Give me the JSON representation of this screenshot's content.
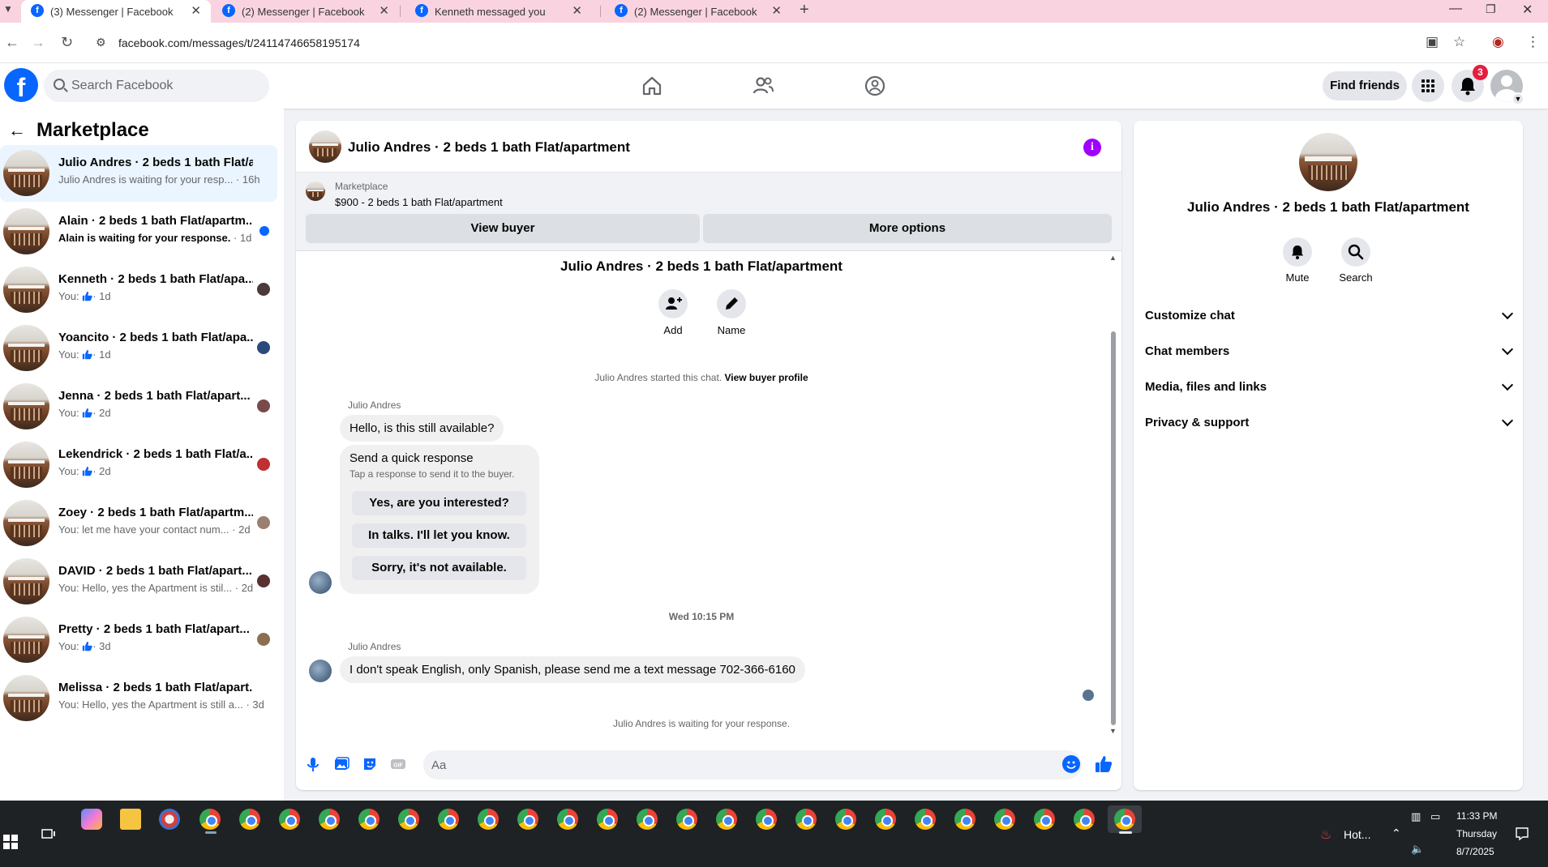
{
  "browser": {
    "tabs": [
      {
        "title": "(3) Messenger | Facebook",
        "active": true
      },
      {
        "title": "(2) Messenger | Facebook",
        "active": false
      },
      {
        "title": "Kenneth messaged you",
        "active": false
      },
      {
        "title": "(2) Messenger | Facebook",
        "active": false
      }
    ],
    "url": "facebook.com/messages/t/24114746658195174"
  },
  "fb_header": {
    "search_placeholder": "Search Facebook",
    "find_friends_label": "Find friends",
    "notification_count": "3"
  },
  "sidebar": {
    "title": "Marketplace",
    "conversations": [
      {
        "name": "Julio Andres · 2 beds 1 bath Flat/a...",
        "preview": "Julio Andres is waiting for your resp...",
        "time": "· 16h",
        "active": true,
        "unread": false
      },
      {
        "name": "Alain · 2 beds 1 bath Flat/apartm...",
        "preview": "Alain is waiting for your response.",
        "time": "· 1d",
        "active": false,
        "unread": true
      },
      {
        "name": "Kenneth · 2 beds 1 bath Flat/apa...",
        "preview": "You:",
        "time": "· 1d",
        "active": false,
        "unread": false
      },
      {
        "name": "Yoancito · 2 beds 1 bath Flat/apa...",
        "preview": "You:",
        "time": "· 1d",
        "active": false,
        "unread": false
      },
      {
        "name": "Jenna · 2 beds 1 bath Flat/apart...",
        "preview": "You:",
        "time": "· 2d",
        "active": false,
        "unread": false
      },
      {
        "name": "Lekendrick · 2 beds 1 bath Flat/a...",
        "preview": "You:",
        "time": "· 2d",
        "active": false,
        "unread": false
      },
      {
        "name": "Zoey · 2 beds 1 bath Flat/apartm...",
        "preview": "You: let me have your contact num...",
        "time": "· 2d",
        "active": false,
        "unread": false
      },
      {
        "name": "DAVID · 2 beds 1 bath Flat/apart...",
        "preview": "You: Hello, yes the Apartment is stil...",
        "time": "· 2d",
        "active": false,
        "unread": false
      },
      {
        "name": "Pretty · 2 beds 1 bath Flat/apart...",
        "preview": "You:",
        "time": "· 3d",
        "active": false,
        "unread": false
      },
      {
        "name": "Melissa · 2 beds 1 bath Flat/apart...",
        "preview": "You: Hello, yes the Apartment is still a...",
        "time": "· 3d",
        "active": false,
        "unread": false
      }
    ]
  },
  "chat": {
    "header_title": "Julio Andres · 2 beds 1 bath Flat/apartment",
    "marketplace_label": "Marketplace",
    "listing": "$900 - 2 beds 1 bath Flat/apartment",
    "view_buyer_label": "View buyer",
    "more_options_label": "More options",
    "conversation_title": "Julio Andres · 2 beds 1 bath Flat/apartment",
    "add_label": "Add",
    "name_label": "Name",
    "started_text": "Julio Andres started this chat.",
    "view_profile_link": "View buyer profile",
    "sender_name": "Julio Andres",
    "message_1": "Hello, is this still available?",
    "quick_response_title": "Send a quick response",
    "quick_response_hint": "Tap a response to send it to the buyer.",
    "quick_responses": [
      "Yes, are you interested?",
      "In talks. I'll let you know.",
      "Sorry, it's not available."
    ],
    "timestamp": "Wed 10:15 PM",
    "message_2": "I don't speak English, only Spanish, please send me a text message 702-366-6160",
    "waiting_text": "Julio Andres is waiting for your response.",
    "composer_placeholder": "Aa"
  },
  "info_panel": {
    "name": "Julio Andres · 2 beds 1 bath Flat/apartment",
    "mute_label": "Mute",
    "search_label": "Search",
    "sections": [
      "Customize chat",
      "Chat members",
      "Media, files and links",
      "Privacy & support"
    ]
  },
  "taskbar": {
    "weather": "Hot...",
    "time": "11:33 PM",
    "day": "Thursday",
    "date": "8/7/2025"
  },
  "colors": {
    "fb_blue": "#0866ff",
    "info_purple": "#a100ff",
    "badge_red": "#e41e3f",
    "tab_strip": "#f9d4e0"
  }
}
